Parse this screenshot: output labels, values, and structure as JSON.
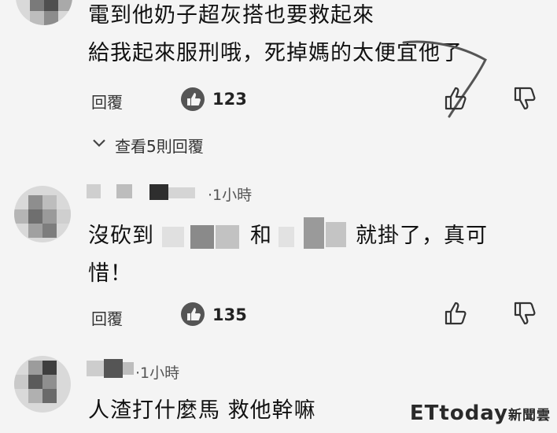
{
  "comments": [
    {
      "lines": [
        "電到他奶子超灰搭也要救起來",
        "給我起來服刑哦，死掉媽的太便宜他了"
      ],
      "reply_label": "回覆",
      "likes": "123",
      "view_replies": "查看5則回覆"
    },
    {
      "time": "1小時",
      "lines": [
        "沒砍到",
        "和",
        "就掛了，真可",
        "惜！"
      ],
      "reply_label": "回覆",
      "likes": "135"
    },
    {
      "time": "1小時",
      "lines": [
        "人渣打什麼馬 救他幹嘛"
      ]
    }
  ],
  "watermark": {
    "brand": "ETtoday",
    "suffix": "新聞雲"
  },
  "icons": [
    "thumb-up-icon",
    "thumb-down-icon",
    "chevron-down-icon",
    "like-circle-icon"
  ]
}
